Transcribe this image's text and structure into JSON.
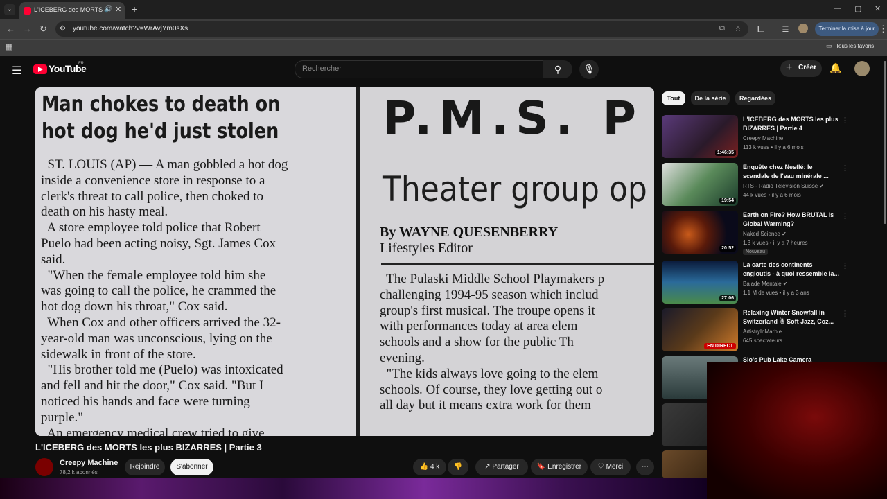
{
  "browser": {
    "tab_title": "L'ICEBERG des MORTS les plus BIZARRES | Partie 3",
    "url": "youtube.com/watch?v=WrAvjYm0sXs",
    "update_label": "Terminer la mise à jour",
    "all_bookmarks": "Tous les favoris"
  },
  "yt": {
    "wordmark": "YouTube",
    "country": "FR",
    "search_placeholder": "Rechercher",
    "create_label": "Créer"
  },
  "newspaper": {
    "headline_line1": "Man chokes to death on",
    "headline_line2": "hot dog he'd just stolen",
    "body": [
      "  ST. LOUIS (AP) — A man gobbled a hot dog",
      "inside a convenience store in response to a",
      "clerk's threat to call police, then choked to",
      "death on his hasty meal.",
      "  A store employee told police that Robert",
      "Puelo had been acting noisy, Sgt. James Cox",
      "said.",
      "  \"When the female employee told him she",
      "was going to call the police, he crammed the",
      "hot dog down his throat,\" Cox said.",
      "  When Cox and other officers arrived the 32-",
      "year-old man was unconscious, lying on the",
      "sidewalk in front of the store.",
      "  \"His brother told me (Puelo) was intoxicated",
      "and fell and hit the door,\" Cox said. \"But I",
      "noticed his hands and face were turning",
      "purple.\"",
      "  An emergency medical crew tried to give"
    ],
    "right_headline": "P.M.S. P",
    "right_subhead": "Theater group op",
    "byline": "By WAYNE QUESENBERRY",
    "byline_title": "Lifestyles Editor",
    "right_body": [
      "  The Pulaski Middle School Playmakers p",
      "challenging 1994-95 season which includ",
      "group's first musical. The troupe opens it",
      "with performances today at area elem",
      "schools and a show for the public Th",
      "evening.",
      "  \"The kids always love going to the elem",
      "schools. Of course, they love getting out o",
      "all day but it means extra work for them"
    ]
  },
  "video": {
    "title": "L'ICEBERG des MORTS les plus BIZARRES | Partie 3",
    "channel": "Creepy Machine",
    "subscribers": "78,2 k abonnés",
    "join_label": "Rejoindre",
    "subscribe_label": "S'abonner",
    "likes": "4 k",
    "share_label": "Partager",
    "save_label": "Enregistrer",
    "thanks_label": "Merci"
  },
  "chips": [
    "Tout",
    "De la série",
    "Regardées"
  ],
  "recommendations": [
    {
      "title": "L'ICEBERG des MORTS les plus BIZARRES | Partie 4",
      "channel": "Creepy Machine",
      "meta": "113 k vues • il y a 6 mois",
      "duration": "1:46:35",
      "thumb_color": "#3a2a4a"
    },
    {
      "title": "Enquête chez Nestlé: le scandale de l'eau minérale ...",
      "channel": "RTS - Radio Télévision Suisse ✔",
      "meta": "44 k vues • il y a 6 mois",
      "duration": "19:54",
      "thumb_color": "#3a5a3a"
    },
    {
      "title": "Earth on Fire? How BRUTAL Is Global Warming?",
      "channel": "Naked Science ✔",
      "meta": "1,3 k vues • il y a 7 heures",
      "duration": "20:52",
      "badge": "Nouveau",
      "thumb_color": "#1a1a2a"
    },
    {
      "title": "La carte des continents engloutis - à quoi ressemble la...",
      "channel": "Balade Mentale ✔",
      "meta": "1,1 M de vues • il y a 3 ans",
      "duration": "27:06",
      "thumb_color": "#2a5a7a"
    },
    {
      "title": "Relaxing Winter Snowfall in Switzerland ☃ Soft Jazz, Coz...",
      "channel": "ArtistryInMarble",
      "meta": "645 spectateurs",
      "live": "EN DIRECT",
      "thumb_color": "#3a2a1a"
    },
    {
      "title": "Slo's Pub Lake Camera",
      "channel": "",
      "meta": "",
      "thumb_color": "#4a5a5a"
    }
  ]
}
